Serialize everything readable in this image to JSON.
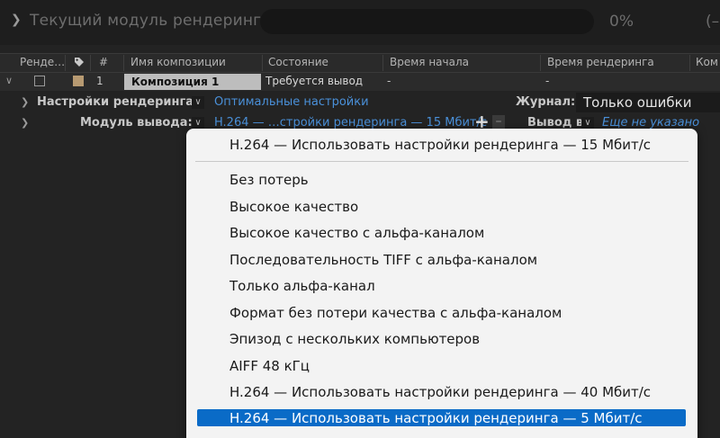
{
  "topbar": {
    "title": "Текущий модуль рендеринга",
    "percent": "0%",
    "extra": "(–"
  },
  "columns": {
    "render": "Ренде…",
    "num": "#",
    "comp_name": "Имя композиции",
    "state": "Состояние",
    "start_time": "Время начала",
    "render_time": "Время рендеринга",
    "comment": "Ком"
  },
  "row": {
    "num": "1",
    "comp": "Композиция 1",
    "state": "Требуется вывод",
    "start": "-",
    "render_time": "-",
    "swatch_color": "#b79a72"
  },
  "render_settings": {
    "label": "Настройки рендеринга:",
    "value": "Оптимальные настройки",
    "log_label": "Журнал:",
    "log_value": "Только ошибки"
  },
  "output_module": {
    "label": "Модуль вывода:",
    "value": "H.264 — …стройки рендеринга — 15 Мбит/с",
    "output_to_label": "Вывод в:",
    "output_to_value": "Еще не указано"
  },
  "menu": {
    "top_item": "H.264 — Использовать настройки рендеринга — 15 Мбит/с",
    "items": [
      "Без потерь",
      "Высокое качество",
      "Высокое качество с альфа-каналом",
      "Последовательность TIFF с альфа-каналом",
      "Только альфа-канал",
      "Формат без потери качества с альфа-каналом",
      "Эпизод с нескольких компьютеров",
      "AIFF 48 кГц",
      "H.264 — Использовать настройки рендеринга — 40 Мбит/с",
      "H.264 — Использовать настройки рендеринга — 5 Мбит/с"
    ],
    "selected_index": 9,
    "highlight_color": "#0a6bc7"
  },
  "colors": {
    "link": "#4a90d9",
    "background": "#232323"
  }
}
